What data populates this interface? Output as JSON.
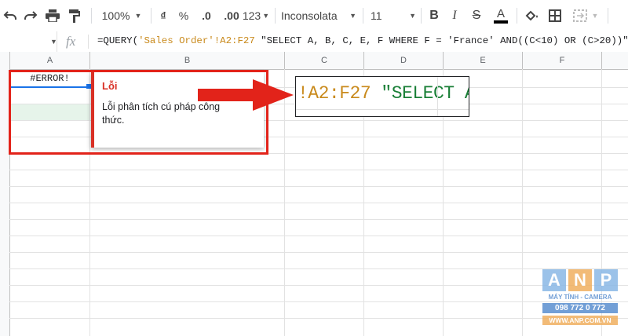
{
  "toolbar": {
    "zoom": "100%",
    "currency": "₫",
    "percent": "%",
    "decrease_decimal": ".0",
    "increase_decimal": ".00",
    "number_format": "123",
    "font": "Inconsolata",
    "font_size": "11",
    "bold": "B",
    "italic": "I",
    "text_color": "A"
  },
  "formula_bar": {
    "fx": "fx",
    "prefix": "=QUERY(",
    "range_ref": "'Sales Order'!A2:F27",
    "query": " \"SELECT A, B, C, E, F WHERE F = 'France' AND((C<10) OR (C>20))\")"
  },
  "columns": [
    "A",
    "B",
    "C",
    "D",
    "E",
    "F"
  ],
  "cell_a1": "#ERROR!",
  "error_tooltip": {
    "title": "Lỗi",
    "message": "Lỗi phân tích cú pháp công thức."
  },
  "zoom_callout": {
    "range_part": "!A2:F27",
    "query_part": " \"SELECT A,"
  },
  "watermark": {
    "letters": [
      "A",
      "N",
      "P"
    ],
    "tagline": "MÁY TÍNH - CAMERA",
    "phone": "098 772 0 772",
    "website": "WWW.ANP.COM.VN"
  },
  "colors": {
    "annotation_red": "#e2231a",
    "error_red": "#d93025",
    "string_orange": "#c98a1c",
    "callout_green": "#1a7f37",
    "anp_blue": "#4a90d9",
    "anp_orange": "#f0a030"
  }
}
